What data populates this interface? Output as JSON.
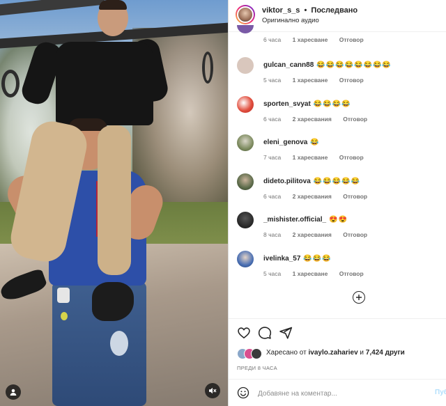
{
  "header": {
    "username": "viktor_s_s",
    "separator": "•",
    "follow_status": "Последвано",
    "audio": "Оригинално аудио"
  },
  "comments": [
    {
      "username": "",
      "text": "",
      "time": "6 часа",
      "likes": "1 харесване",
      "reply": "Отговор",
      "avatar_color": "#7a5aa6"
    },
    {
      "username": "gulcan_cann88",
      "text": "😂😂😂😂😂😂😂😂",
      "time": "5 часа",
      "likes": "1 харесване",
      "reply": "Отговор",
      "avatar_color": "#d9c7bd"
    },
    {
      "username": "sporten_svyat",
      "text": "😂😂😂😂",
      "time": "6 часа",
      "likes": "2 харесвания",
      "reply": "Отговор",
      "avatar_color": "#c9352e"
    },
    {
      "username": "eleni_genova",
      "text": "😂",
      "time": "7 часа",
      "likes": "1 харесване",
      "reply": "Отговор",
      "avatar_color": "#7d8b5f"
    },
    {
      "username": "dideto.pilitova",
      "text": "😂😂😂😂😂",
      "time": "6 часа",
      "likes": "2 харесвания",
      "reply": "Отговор",
      "avatar_color": "#5c6b4a"
    },
    {
      "username": "_mishister.official_",
      "text": "😍😍",
      "time": "8 часа",
      "likes": "2 харесвания",
      "reply": "Отговор",
      "avatar_color": "#2b2b2b"
    },
    {
      "username": "ivelinka_57",
      "text": "😂😂😂",
      "time": "5 часа",
      "likes": "1 харесване",
      "reply": "Отговор",
      "avatar_color": "#4a6fb3"
    }
  ],
  "likes": {
    "prefix": "Харесано от",
    "user": "ivaylo.zahariev",
    "conj": "и",
    "count": "7,424 други"
  },
  "time_ago": "ПРЕДИ 8 ЧАСА",
  "add_comment": {
    "placeholder": "Добавяне на коментар...",
    "post_label": "Публикуване"
  },
  "icons": {
    "like": "heart-icon",
    "comment": "comment-bubble-icon",
    "share": "paper-plane-icon",
    "more_comments": "plus-circle-icon",
    "emoji": "smiley-icon",
    "tag": "user-tag-icon",
    "mute": "speaker-muted-icon"
  },
  "colors": {
    "text": "#262626",
    "secondary": "#737373",
    "link_disabled": "#b2dffc",
    "border": "#dbdbdb"
  }
}
